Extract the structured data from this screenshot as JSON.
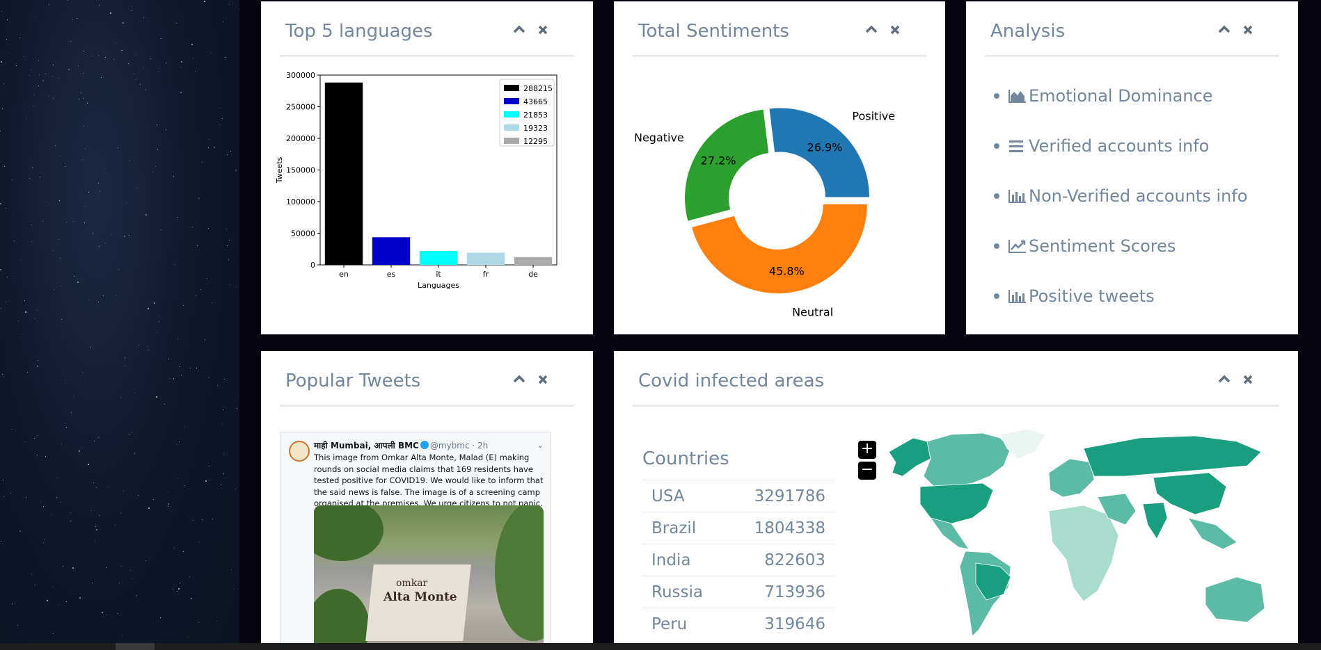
{
  "panels": {
    "languages": {
      "title": "Top 5 languages",
      "chart_data": {
        "type": "bar",
        "categories": [
          "en",
          "es",
          "it",
          "fr",
          "de"
        ],
        "values": [
          288215,
          43665,
          21853,
          19323,
          12295
        ],
        "colors": [
          "#000000",
          "#0000cd",
          "#00ffff",
          "#add8e6",
          "#a9a9a9"
        ],
        "legend": [
          "288215",
          "43665",
          "21853",
          "19323",
          "12295"
        ],
        "legend_position": "top-right",
        "xlabel": "Languages",
        "ylabel": "Tweets",
        "yticks": [
          "0",
          "50000",
          "100000",
          "150000",
          "200000",
          "250000",
          "300000"
        ],
        "ylim": [
          0,
          300000
        ],
        "grid": false
      }
    },
    "sentiments": {
      "title": "Total Sentiments",
      "chart_data": {
        "type": "pie",
        "donut": true,
        "labels": [
          "Positive",
          "Negative",
          "Neutral"
        ],
        "values": [
          26.9,
          27.2,
          45.8
        ],
        "value_labels": [
          "26.9%",
          "27.2%",
          "45.8%"
        ],
        "colors": [
          "#1f77b4",
          "#2ca02c",
          "#ff7f0e"
        ]
      }
    },
    "analysis": {
      "title": "Analysis",
      "items": [
        {
          "label": "Emotional Dominance",
          "icon": "area-chart-icon"
        },
        {
          "label": "Verified accounts info",
          "icon": "list-icon"
        },
        {
          "label": "Non-Verified accounts info",
          "icon": "bar-chart-icon"
        },
        {
          "label": "Sentiment Scores",
          "icon": "line-chart-icon"
        },
        {
          "label": "Positive tweets",
          "icon": "bar-chart-icon"
        }
      ]
    },
    "popular": {
      "title": "Popular Tweets",
      "tweet": {
        "name": "माही Mumbai, आपली BMC",
        "handle": "@mybmc · 2h",
        "text": "This image from Omkar Alta Monte, Malad (E) making rounds on social media claims that 169 residents have tested positive for COVID19. We would like to inform that the said news is false. The image is of a screening camp organised at the premises. We urge citizens to not panic.",
        "image_sign_1": "omkar",
        "image_sign_2": "Alta Monte"
      }
    },
    "covid": {
      "title": "Covid infected areas",
      "countries_title": "Countries",
      "rows": [
        {
          "country": "USA",
          "count": "3291786"
        },
        {
          "country": "Brazil",
          "count": "1804338"
        },
        {
          "country": "India",
          "count": "822603"
        },
        {
          "country": "Russia",
          "count": "713936"
        },
        {
          "country": "Peru",
          "count": "319646"
        }
      ],
      "zoom_in": "+",
      "zoom_out": "−",
      "map_colors": {
        "high": "#1a9e80",
        "mid": "#5cbba6",
        "low": "#a8dccd"
      }
    }
  },
  "icons": {
    "collapse": "chevron-up-icon",
    "close": "close-icon"
  }
}
